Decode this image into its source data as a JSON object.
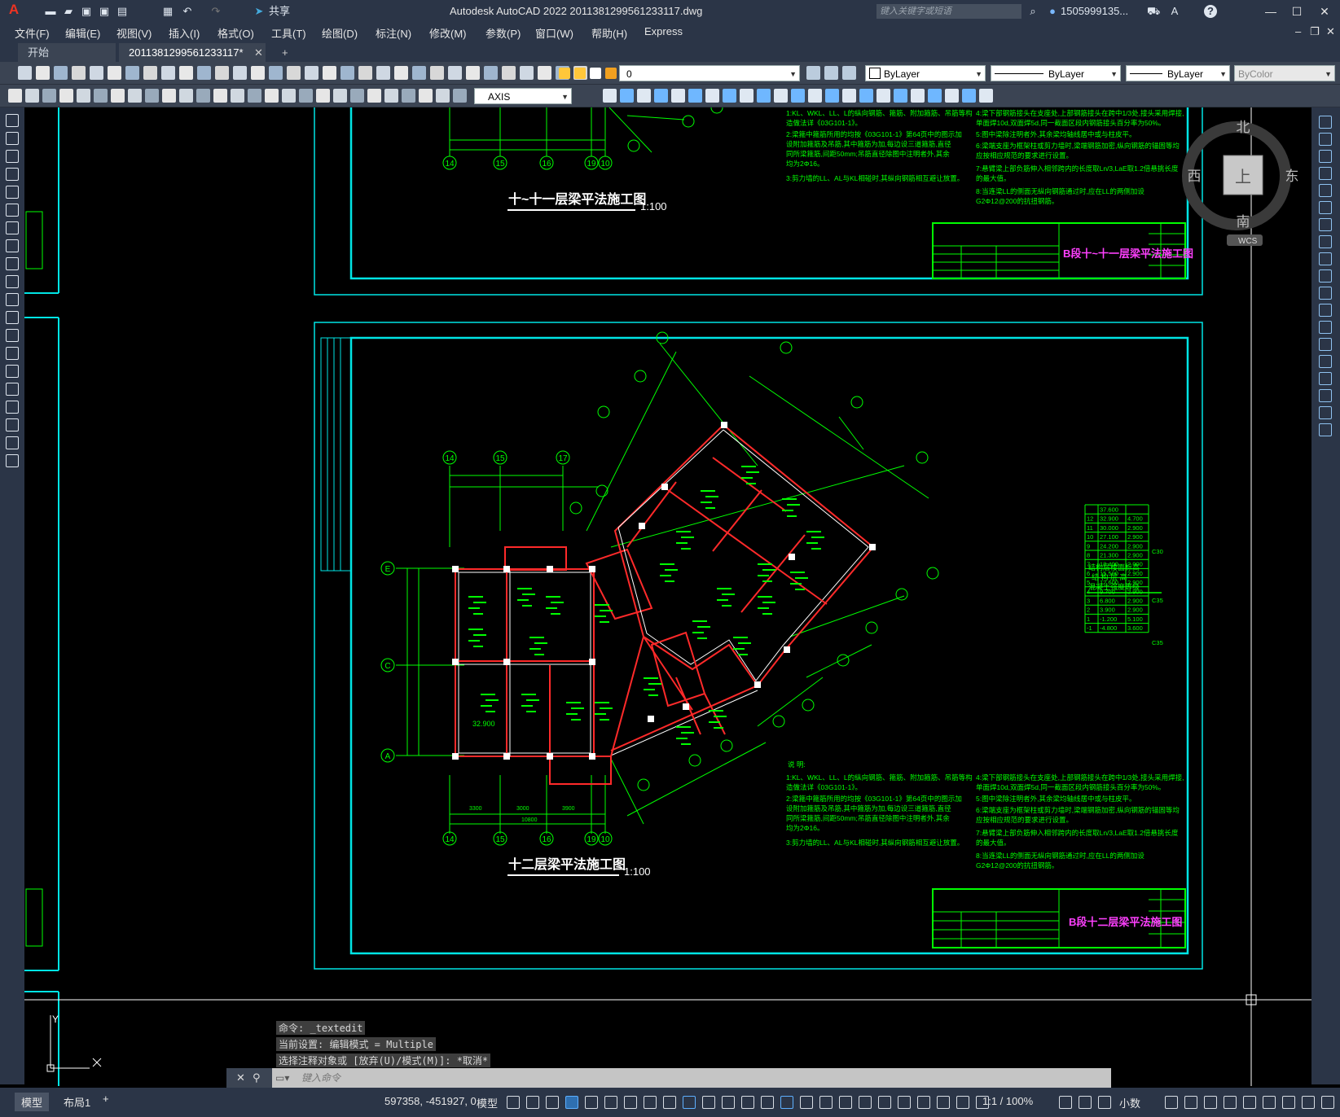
{
  "app": {
    "title": "Autodesk AutoCAD 2022    2011381299561233117.dwg",
    "share_label": "共享",
    "search_placeholder": "键入关键字或短语",
    "user_label": "1505999135...",
    "logo": "A"
  },
  "menu": [
    "文件(F)",
    "编辑(E)",
    "视图(V)",
    "插入(I)",
    "格式(O)",
    "工具(T)",
    "绘图(D)",
    "标注(N)",
    "修改(M)",
    "参数(P)",
    "窗口(W)",
    "帮助(H)",
    "Express"
  ],
  "tabs": {
    "start": "开始",
    "active": "2011381299561233117*",
    "add": "+"
  },
  "properties": {
    "layer": "0",
    "color": "ByLayer",
    "linetype": "ByLayer",
    "lineweight": "ByLayer",
    "plotstyle": "ByColor",
    "dimstyle": "AXIS"
  },
  "viewcube": {
    "north": "北",
    "south": "南",
    "east": "东",
    "west": "西",
    "top": "上",
    "wcs": "WCS"
  },
  "drawing": {
    "upper_title": "十~十一层梁平法施工图",
    "lower_title": "十二层梁平法施工图",
    "scale": "1:100",
    "upper_stamp": "B段十~十一层梁平法施工图",
    "lower_stamp": "B段十二层梁平法施工图",
    "elevation": "32.900",
    "notes_heading": "说 明:",
    "axis_bottom": [
      "14",
      "15",
      "16",
      "19",
      "10"
    ],
    "axis_left": [
      "E",
      "C",
      "A"
    ],
    "dims_bottom": [
      "3300",
      "3000",
      "3900",
      "10800"
    ],
    "notes_left": [
      "1:KL、WKL、LL、L的纵向钢筋、箍筋、附加箍筋、吊筋等构",
      "  造做法详《03G101-1》。",
      "2:梁箍中箍筋所用的均按《03G101-1》第64页中的图示加",
      "  设附加箍筋及吊筋,其中箍筋为加,每边设三道箍筋,直径",
      "  同所梁箍筋,间距50mm;吊筋直径除图中注明者外,其余",
      "  均为2Φ16。",
      "3:剪力墙的LL、AL与KL相碰时,其纵向钢筋相互避让放置。"
    ],
    "notes_right": [
      "4:梁下部钢筋接头在支座处,上部钢筋接头在跨中1/3处,接头采用焊接,",
      "  单面焊10d,双面焊5d,同一截面区段内钢筋接头百分率为50%。",
      "5:图中梁除注明者外,其余梁均轴线居中或与柱皮平。",
      "6:梁端支座为框架柱或剪力墙时,梁端钢筋加密,纵向钢筋的锚固等均",
      "  应按相应规范的要求进行设置。",
      "7:悬臂梁上部负筋伸入相邻跨内的长度取Ln/3,LaE取1.2倍悬挑长度",
      "  的最大值。",
      "8:当连梁LL的侧面无纵向钢筋通过时,应在LL的两侧加设",
      "  G2Φ12@200的抗扭钢筋。"
    ],
    "level_table": {
      "rows": [
        [
          "",
          "37.600",
          ""
        ],
        [
          "12",
          "32.900",
          "4.700"
        ],
        [
          "11",
          "30.000",
          "2.900"
        ],
        [
          "10",
          "27.100",
          "2.900"
        ],
        [
          "9",
          "24.200",
          "2.900"
        ],
        [
          "8",
          "21.300",
          "2.900"
        ],
        [
          "7",
          "18.400",
          "2.900"
        ],
        [
          "6",
          "15.500",
          "2.900"
        ],
        [
          "5",
          "12.600",
          "2.900"
        ],
        [
          "4",
          "9.700",
          "2.900"
        ],
        [
          "3",
          "6.800",
          "2.900"
        ],
        [
          "2",
          "3.900",
          "2.900"
        ],
        [
          "1",
          "-1.200",
          "5.100"
        ],
        [
          "-1",
          "-4.800",
          "3.600"
        ]
      ],
      "caption1": "结构层楼面标高",
      "caption2": "结 构 层 高",
      "caption3": "混凝土强度等级",
      "grades": [
        "C30",
        "C35",
        "C35"
      ]
    }
  },
  "command": {
    "history": [
      "命令: _textedit",
      "当前设置: 编辑模式 = Multiple",
      "选择注释对象或 [放弃(U)/模式(M)]: *取消*"
    ],
    "prompt": "键入命令"
  },
  "status": {
    "model_tab": "模型",
    "layout_tab": "布局1",
    "add": "+",
    "coords": "597358, -451927, 0",
    "space": "模型",
    "annotation_scale": "1:1 / 100%",
    "units": "小数"
  },
  "colors": {
    "titlebar": "#2b3547",
    "toolbar": "#3b4453",
    "cyan_frame": "#00e5e5",
    "green_text": "#00ff00",
    "wall_red": "#ff2020"
  }
}
